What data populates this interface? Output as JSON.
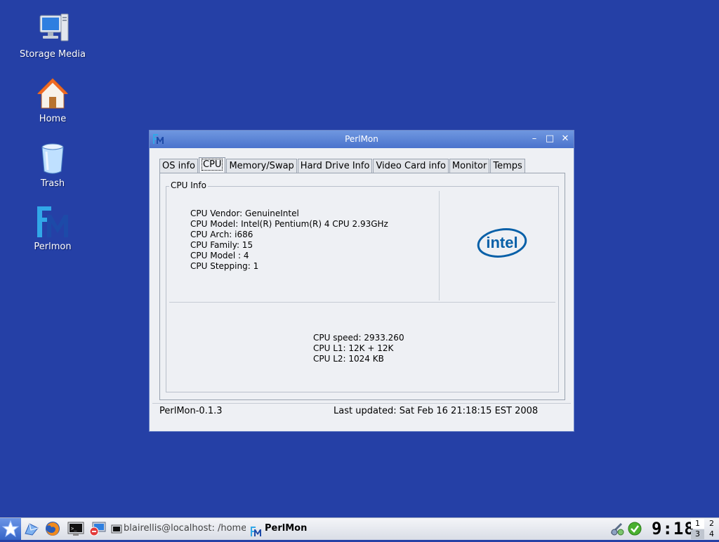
{
  "desktop": {
    "icons": [
      {
        "label": "Storage Media"
      },
      {
        "label": "Home"
      },
      {
        "label": "Trash"
      },
      {
        "label": "Perlmon"
      }
    ]
  },
  "window": {
    "title": "PerlMon",
    "app_logo": "FM",
    "controls": {
      "minimize": "–",
      "maximize": "□",
      "close": "✕"
    },
    "tabs": [
      "OS info",
      "CPU",
      "Memory/Swap",
      "Hard Drive Info",
      "Video Card info",
      "Monitor",
      "Temps"
    ],
    "active_tab": "CPU",
    "group_title": "CPU Info",
    "cpu_lines": [
      "CPU Vendor: GenuineIntel",
      "CPU Model: Intel(R) Pentium(R) 4 CPU 2.93GHz",
      "CPU Arch: i686",
      "CPU Family: 15",
      "CPU Model : 4",
      "CPU Stepping: 1"
    ],
    "logo_text": "intel",
    "cache_lines": [
      "CPU speed: 2933.260",
      "CPU L1: 12K + 12K",
      "CPU L2: 1024 KB"
    ],
    "version": "PerlMon-0.1.3",
    "last_updated": "Last updated:  Sat Feb 16 21:18:15 EST 2008"
  },
  "taskbar": {
    "tasks": [
      {
        "label": "blairellis@localhost: /home/"
      },
      {
        "label": "PerlMon"
      }
    ],
    "task_logo": "FM",
    "clock": "9:18",
    "pager": [
      "1",
      "2",
      "3",
      "4"
    ],
    "accent": "#2540a6"
  }
}
